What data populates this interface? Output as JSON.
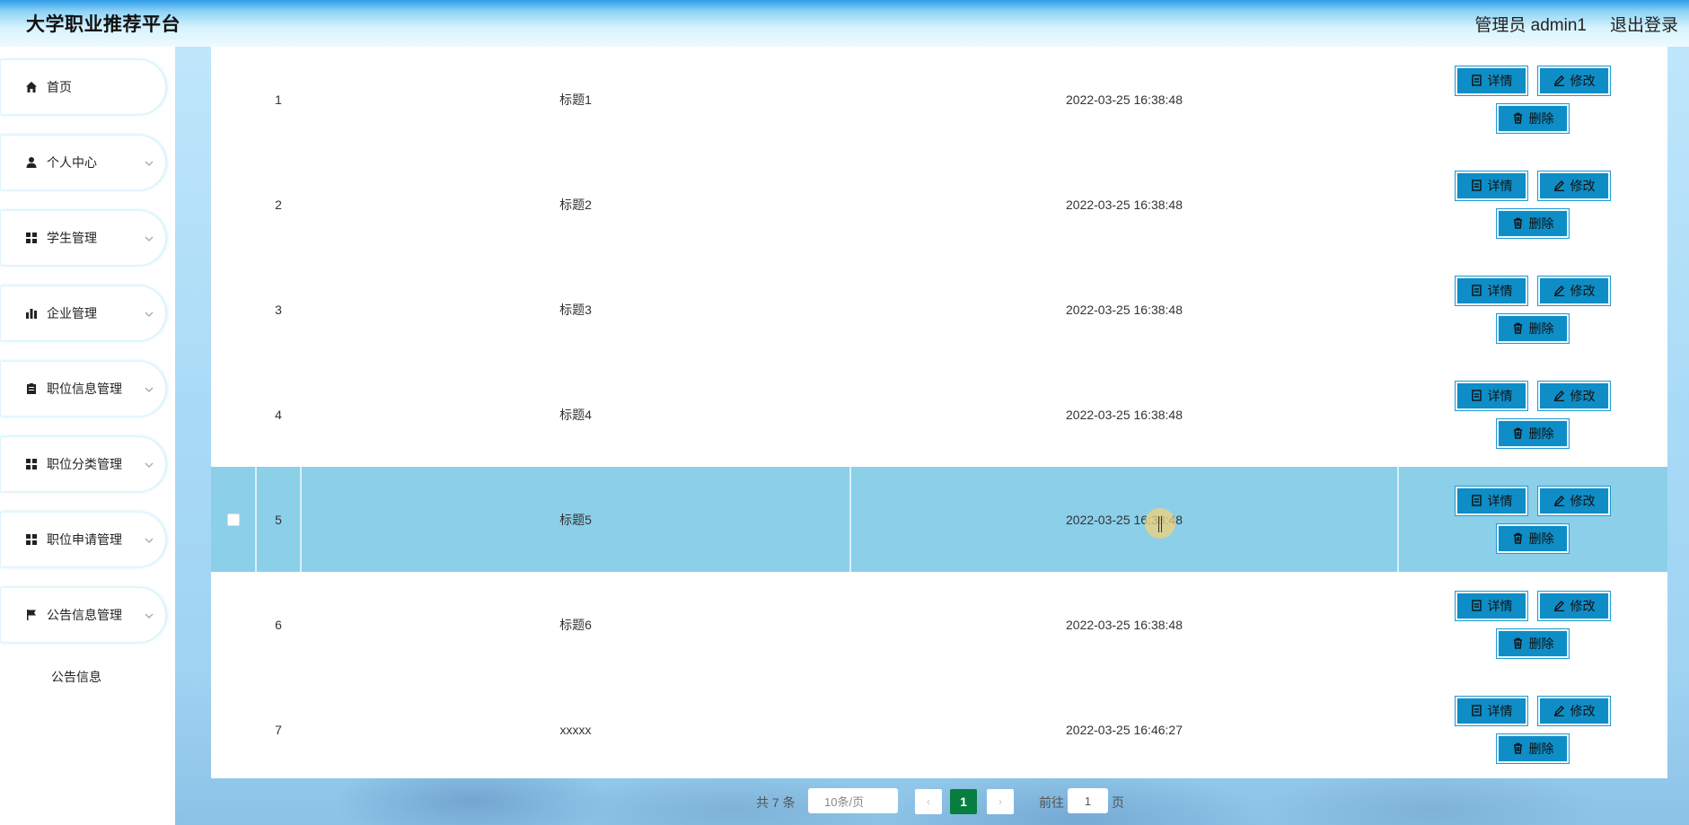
{
  "header": {
    "title": "大学职业推荐平台",
    "user_label": "管理员 admin1",
    "logout_label": "退出登录"
  },
  "sidebar": {
    "items": [
      {
        "label": "首页",
        "icon": "home-icon",
        "has_children": false
      },
      {
        "label": "个人中心",
        "icon": "user-icon",
        "has_children": true
      },
      {
        "label": "学生管理",
        "icon": "grid-icon",
        "has_children": true
      },
      {
        "label": "企业管理",
        "icon": "bar-chart-icon",
        "has_children": true
      },
      {
        "label": "职位信息管理",
        "icon": "clipboard-icon",
        "has_children": true
      },
      {
        "label": "职位分类管理",
        "icon": "grid-icon",
        "has_children": true
      },
      {
        "label": "职位申请管理",
        "icon": "grid-icon",
        "has_children": true
      },
      {
        "label": "公告信息管理",
        "icon": "flag-icon",
        "has_children": true
      }
    ],
    "submenu": {
      "label": "公告信息"
    }
  },
  "table": {
    "rows": [
      {
        "index": "1",
        "title": "标题1",
        "time": "2022-03-25 16:38:48"
      },
      {
        "index": "2",
        "title": "标题2",
        "time": "2022-03-25 16:38:48"
      },
      {
        "index": "3",
        "title": "标题3",
        "time": "2022-03-25 16:38:48"
      },
      {
        "index": "4",
        "title": "标题4",
        "time": "2022-03-25 16:38:48"
      },
      {
        "index": "5",
        "title": "标题5",
        "time": "2022-03-25 16:38:48",
        "highlighted": true
      },
      {
        "index": "6",
        "title": "标题6",
        "time": "2022-03-25 16:38:48"
      },
      {
        "index": "7",
        "title": "xxxxx",
        "time": "2022-03-25 16:46:27"
      }
    ],
    "actions": {
      "detail": "详情",
      "edit": "修改",
      "delete": "删除"
    }
  },
  "pagination": {
    "total": "共 7 条",
    "page_size": "10条/页",
    "current_page": "1",
    "goto_label": "前往",
    "goto_value": "1",
    "page_suffix": "页"
  },
  "colors": {
    "accent_button": "#0e8dc6",
    "row_highlight": "#8ccfe9",
    "current_page": "#067e3f"
  }
}
